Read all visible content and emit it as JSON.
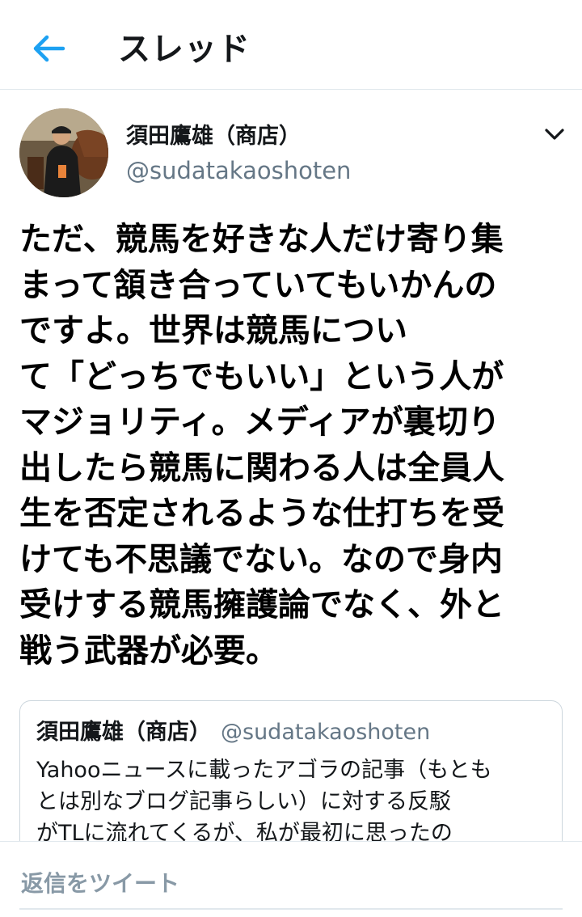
{
  "header": {
    "title": "スレッド",
    "back_icon": "back-arrow-icon",
    "accent_color": "#1da1f2"
  },
  "tweet": {
    "author_name": "須田鷹雄（商店）",
    "author_handle": "@sudatakaoshoten",
    "menu_icon": "chevron-down-icon",
    "text_lines": [
      "ただ、競馬を好きな人だけ寄り集",
      "まって頷き合っていてもいかんの",
      "ですよ。世界は競馬につい",
      "て「どっちでもいい」という人が",
      "マジョリティ。メディアが裏切り",
      "出したら競馬に関わる人は全員人",
      "生を否定されるような仕打ちを受",
      "けても不思議でない。なので身内",
      "受けする競馬擁護論でなく、外と",
      "戦う武器が必要。"
    ]
  },
  "quoted_tweet": {
    "author_name": "須田鷹雄（商店）",
    "author_handle": "@sudatakaoshoten",
    "text_lines": [
      "Yahooニュースに載ったアゴラの記事（もとも",
      "とは別なブログ記事らしい）に対する反駁",
      "がTLに流れてくるが、私が最初に思ったの"
    ]
  },
  "reply": {
    "placeholder": "返信をツイート"
  }
}
